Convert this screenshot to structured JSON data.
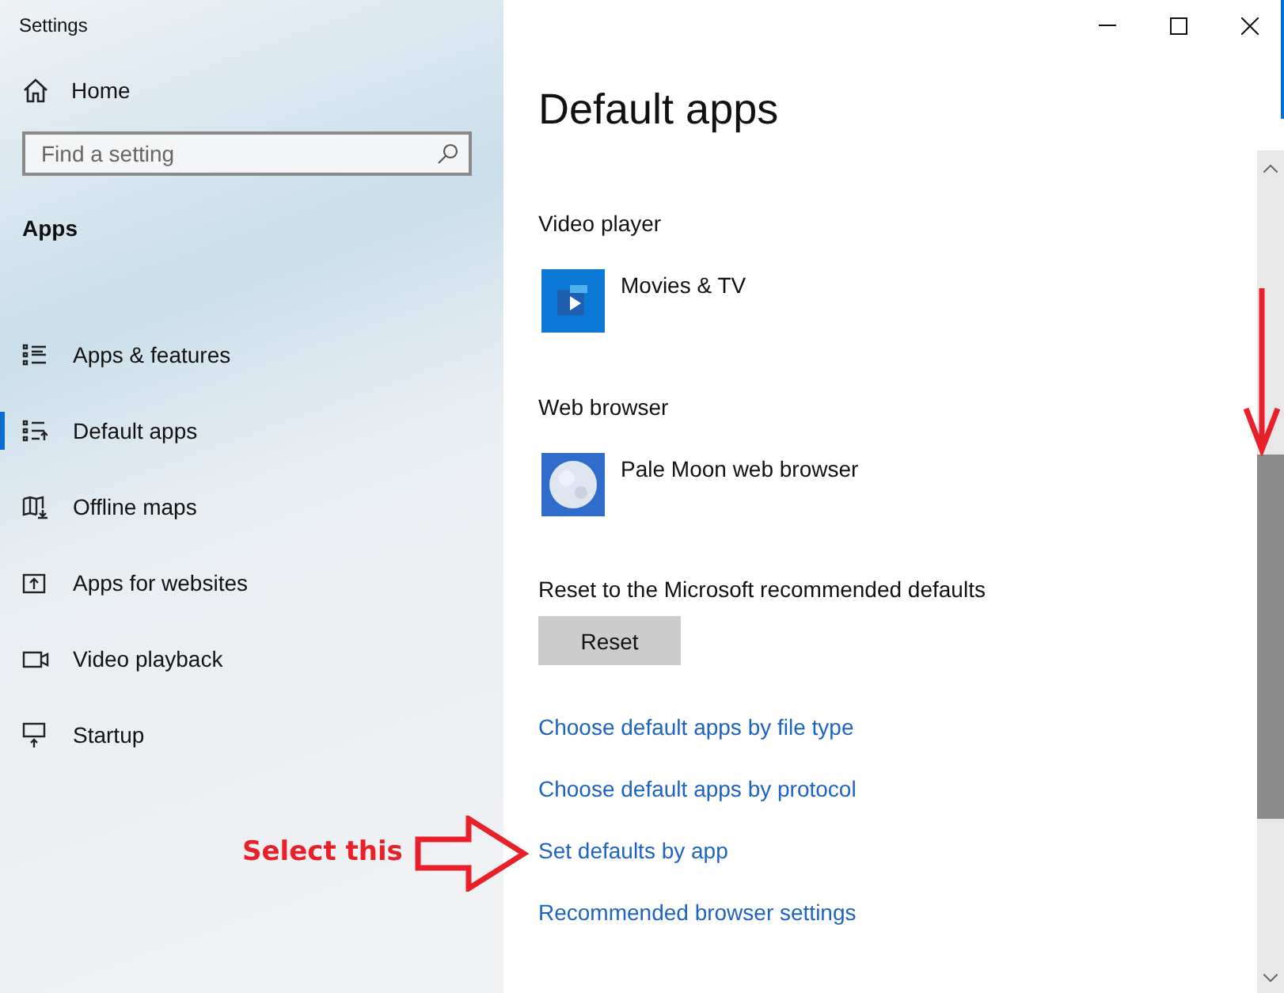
{
  "window": {
    "title": "Settings"
  },
  "sidebar": {
    "home": "Home",
    "search": {
      "placeholder": "Find a setting"
    },
    "section": "Apps",
    "items": [
      {
        "label": "Apps & features",
        "selected": false
      },
      {
        "label": "Default apps",
        "selected": true
      },
      {
        "label": "Offline maps",
        "selected": false
      },
      {
        "label": "Apps for websites",
        "selected": false
      },
      {
        "label": "Video playback",
        "selected": false
      },
      {
        "label": "Startup",
        "selected": false
      }
    ]
  },
  "page": {
    "title": "Default apps",
    "defaults": [
      {
        "label": "Video player",
        "app": "Movies & TV"
      },
      {
        "label": "Web browser",
        "app": "Pale Moon web browser"
      }
    ],
    "reset": {
      "label": "Reset to the Microsoft recommended defaults",
      "button": "Reset"
    },
    "links": [
      "Choose default apps by file type",
      "Choose default apps by protocol",
      "Set defaults by app",
      "Recommended browser settings"
    ]
  },
  "annotation": {
    "text": "Select this"
  }
}
